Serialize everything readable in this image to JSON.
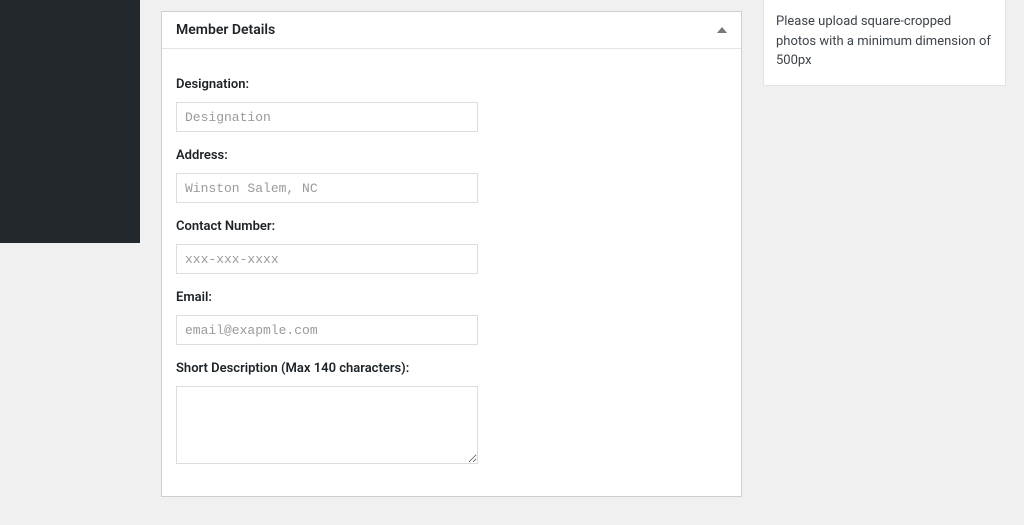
{
  "panel": {
    "title": "Member Details"
  },
  "fields": {
    "designation": {
      "label": "Designation:",
      "placeholder": "Designation",
      "value": ""
    },
    "address": {
      "label": "Address:",
      "placeholder": "Winston Salem, NC",
      "value": ""
    },
    "contact": {
      "label": "Contact Number:",
      "placeholder": "xxx-xxx-xxxx",
      "value": ""
    },
    "email": {
      "label": "Email:",
      "placeholder": "email@exapmle.com",
      "value": ""
    },
    "shortdesc": {
      "label": "Short Description (Max 140 characters):",
      "value": ""
    }
  },
  "sidenote": {
    "text": "Please upload square-cropped photos with a minimum dimension of 500px"
  }
}
